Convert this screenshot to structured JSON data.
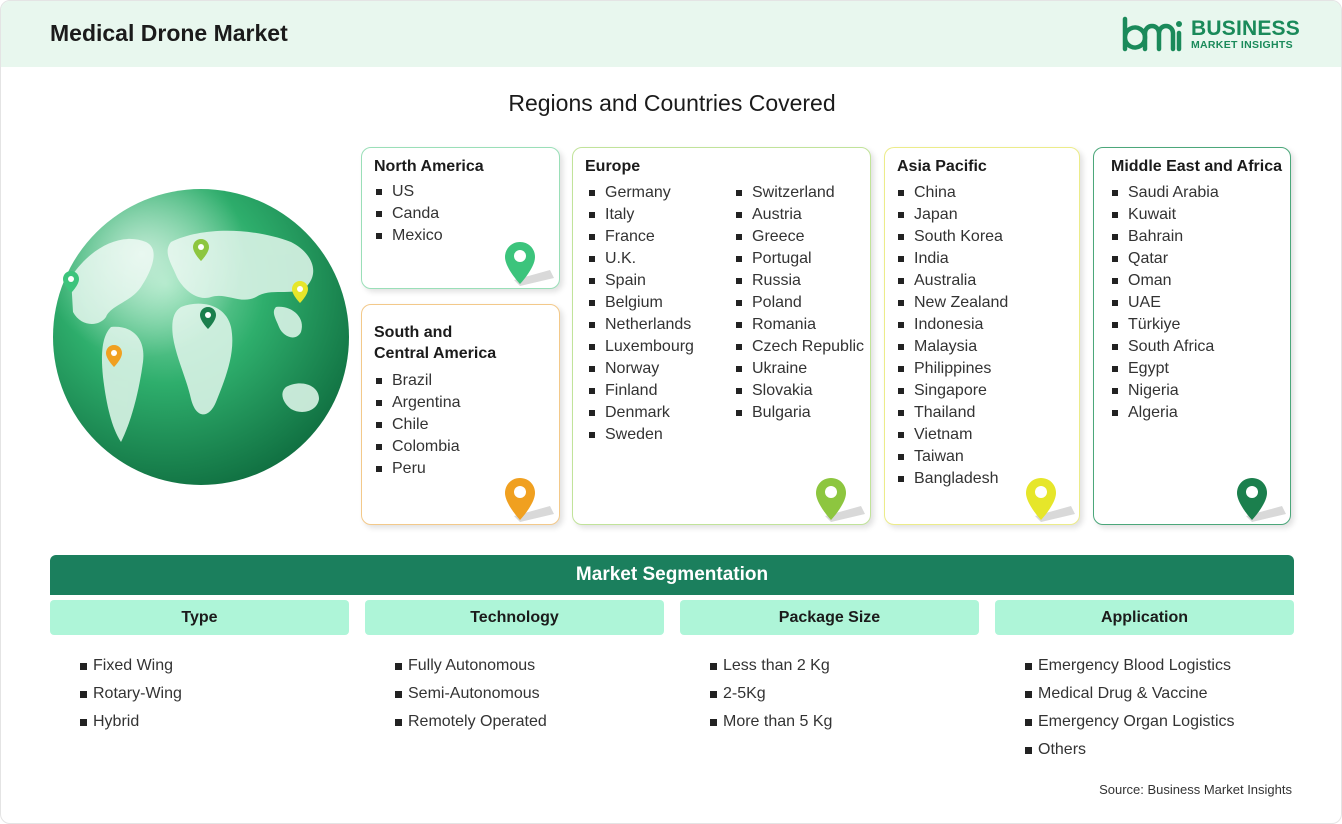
{
  "header": {
    "title": "Medical Drone Market",
    "logo": {
      "brand": "BUSINESS",
      "sub": "MARKET INSIGHTS",
      "mark_text": "bmi"
    }
  },
  "regions_title": "Regions and Countries Covered",
  "regions": {
    "north_america": {
      "title": "North America",
      "countries": [
        "US",
        "Canda",
        "Mexico"
      ],
      "pin_color": "#3cc47c"
    },
    "south_america": {
      "title_line1": "South and",
      "title_line2": "Central America",
      "countries": [
        "Brazil",
        "Argentina",
        "Chile",
        "Colombia",
        "Peru"
      ],
      "pin_color": "#f0a020"
    },
    "europe": {
      "title": "Europe",
      "countries_col1": [
        "Germany",
        "Italy",
        "France",
        "U.K.",
        "Spain",
        "Belgium",
        "Netherlands",
        "Luxembourg",
        "Norway",
        "Finland",
        "Denmark",
        "Sweden"
      ],
      "countries_col2": [
        "Switzerland",
        "Austria",
        "Greece",
        "Portugal",
        "Russia",
        "Poland",
        "Romania",
        "Czech Republic",
        "Ukraine",
        "Slovakia",
        "Bulgaria"
      ],
      "pin_color": "#8dc63f"
    },
    "asia_pacific": {
      "title": "Asia Pacific",
      "countries": [
        "China",
        "Japan",
        "South Korea",
        "India",
        "Australia",
        "New Zealand",
        "Indonesia",
        "Malaysia",
        "Philippines",
        "Singapore",
        "Thailand",
        "Vietnam",
        "Taiwan",
        "Bangladesh"
      ],
      "pin_color": "#e6e62a"
    },
    "middle_east_africa": {
      "title": "Middle East and Africa",
      "countries": [
        "Saudi Arabia",
        "Kuwait",
        "Bahrain",
        "Qatar",
        "Oman",
        "UAE",
        "Türkiye",
        "South Africa",
        "Egypt",
        "Nigeria",
        "Algeria"
      ],
      "pin_color": "#1b7f4d"
    }
  },
  "segmentation": {
    "title": "Market Segmentation",
    "columns": [
      {
        "heading": "Type",
        "items": [
          "Fixed Wing",
          "Rotary-Wing",
          "Hybrid"
        ]
      },
      {
        "heading": "Technology",
        "items": [
          "Fully Autonomous",
          "Semi-Autonomous",
          "Remotely Operated"
        ]
      },
      {
        "heading": "Package Size",
        "items": [
          "Less than 2 Kg",
          "2-5Kg",
          "More than 5 Kg"
        ]
      },
      {
        "heading": "Application",
        "items": [
          "Emergency Blood Logistics",
          "Medical Drug & Vaccine",
          "Emergency Organ Logistics",
          "Others"
        ]
      }
    ]
  },
  "source": "Source: Business Market Insights",
  "colors": {
    "brand_green": "#1b7f5d",
    "header_bg": "#e8f7ee",
    "seg_head_bg": "#aef5d8"
  }
}
